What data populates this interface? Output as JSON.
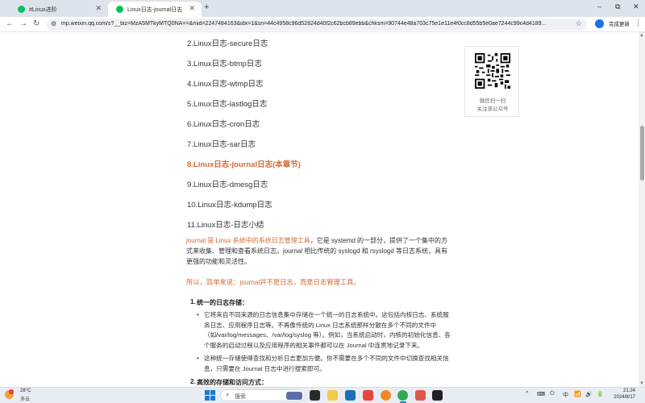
{
  "browser": {
    "tabs": [
      {
        "label": "#Linux进阶",
        "active": false
      },
      {
        "label": "Linux日志-journal日志",
        "active": true
      }
    ],
    "new_tab_icon": "+",
    "window_controls": {
      "minimize": "–",
      "maximize": "⧉",
      "close": "✕"
    },
    "url": "mp.weixin.qq.com/s?__biz=MzA5MTkyMTQ0NA==&mid=2247484163&idx=1&sn=44c4958c96d52824d40f2c62bcb89ebb&chksm=90744e48a703c75e1e11e4f0cc8d55b5e0ae7244c99c4d4189...",
    "update_button_label": "完成更新",
    "accent_color": "#1a73e8"
  },
  "article": {
    "toc": [
      "2.Linux日志-secure日志",
      "3.Linux日志-btmp日志",
      "4.Linux日志-wtmp日志",
      "5.Linux日志-lastlog日志",
      "6.Linux日志-cron日志",
      "7.Linux日志-sar日志",
      "8.Linux日志-journal日志(本章节)",
      "9.Linux日志-dmesg日志",
      "10.Linux日志-kdump日志",
      "11.Linux日志-日志小结"
    ],
    "current_toc_index": 6,
    "highlight_color": "#d46a34",
    "intro_highlight": "journal 是 Linux 系统中的系统日志管理工具",
    "intro_rest": "，它是 systemd 的一部分，提供了一个集中的方式来收集、管理和查看系统日志。journal 相比传统的 syslogd 和 rsyslogd 等日志系统，具有更强的功能和灵活性。",
    "summary": "所以，简单来说：journal并不是日志，而是日志管理工具。",
    "sections": [
      {
        "number": "1.",
        "title": "统一的日志存储",
        "title_suffix": "：",
        "bullets": [
          "它将来自不同来源的日志信息集中存储在一个统一的日志系统中。这包括内核日志、系统服务日志、应用程序日志等。不再像传统的 Linux 日志系统那样分散在多个不同的文件中（如/var/log/messages、/var/log/syslog 等）。例如，当系统启动时，内核的初始化信息、各个服务的启动过程以及应用程序的相关事件都可以在 Journal 中连贯地记录下来。",
          "这种统一存储使得查找和分析日志更加方便。你不需要在多个不同的文件中切换查找相关信息，只需要在 Journal 日志中进行搜索即可。"
        ]
      },
      {
        "number": "2.",
        "title": "高效的存储和访问方式",
        "title_suffix": "："
      }
    ]
  },
  "qr_card": {
    "line1": "微信扫一扫",
    "line2": "关注该公众号"
  },
  "taskbar": {
    "weather_temp": "28°C",
    "weather_desc": "多云",
    "weather_badge": "1",
    "search_label": "搜索",
    "tray_icons": [
      "^",
      "⌨",
      "⏻",
      "中",
      "📶",
      "🔊",
      "🔋"
    ],
    "time": "21:24",
    "date": "2024/8/17"
  }
}
